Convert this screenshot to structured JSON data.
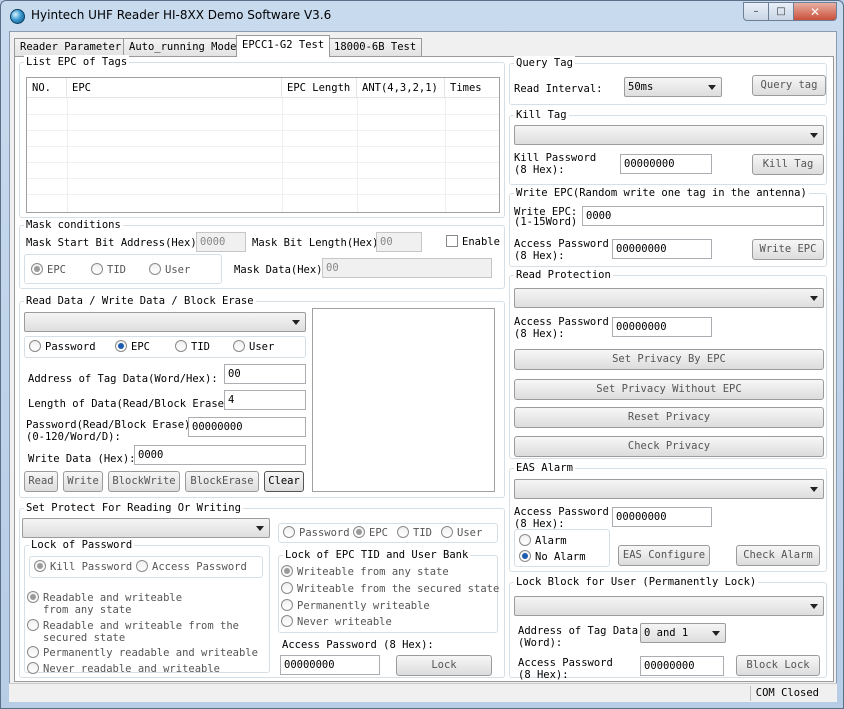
{
  "window": {
    "title": "Hyintech UHF Reader HI-8XX Demo Software V3.6",
    "min_glyph": "–",
    "max_glyph": "□",
    "close_glyph": "✕"
  },
  "tabs": [
    "Reader Parameter",
    "Auto_running Mode",
    "EPCC1-G2 Test",
    "18000-6B Test"
  ],
  "list_epc": {
    "title": "List EPC of Tags",
    "columns": [
      "NO.",
      "EPC",
      "EPC Length",
      "ANT(4,3,2,1)",
      "Times"
    ]
  },
  "mask": {
    "title": "Mask conditions",
    "start_bit_label": "Mask Start Bit Address(Hex):",
    "start_bit_value": "0000",
    "bit_length_label": "Mask Bit Length(Hex):",
    "bit_length_value": "00",
    "enable_label": "Enable",
    "radios": [
      "EPC",
      "TID",
      "User"
    ],
    "data_label": "Mask Data(Hex):",
    "data_value": "00"
  },
  "rw": {
    "title": "Read Data / Write Data / Block Erase",
    "combo_value": "",
    "radios": [
      "Password",
      "EPC",
      "TID",
      "User"
    ],
    "addr_label": "Address of Tag Data(Word/Hex):",
    "addr_value": "00",
    "len_label": "Length of Data(Read/Block Erase:",
    "len_value": "4",
    "pwd_label_1": "Password(Read/Block Erase)",
    "pwd_label_2": "(0-120/Word/D):",
    "pwd_value": "00000000",
    "write_label": "Write Data (Hex):",
    "write_value": "0000",
    "buttons": [
      "Read",
      "Write",
      "BlockWrite",
      "BlockErase",
      "Clear"
    ]
  },
  "protect": {
    "title": "Set Protect For Reading Or Writing",
    "combo_value": "",
    "lock_pwd_title": "Lock of Password",
    "lock_pwd_radios": [
      "Kill Password",
      "Access Password"
    ],
    "mem_radios": [
      "Password",
      "EPC",
      "TID",
      "User"
    ],
    "lock_bank_title": "Lock of EPC TID and User Bank",
    "left_opts": [
      [
        "Readable and  writeable",
        "from any state"
      ],
      [
        "Readable and writeable from the",
        "secured state"
      ],
      [
        "Permanently readable and writeable"
      ],
      [
        "Never readable and writeable"
      ]
    ],
    "right_opts": [
      "Writeable from any state",
      "Writeable from the secured state",
      "Permanently writeable",
      "Never writeable"
    ],
    "access_label": "Access Password (8 Hex):",
    "access_value": "00000000",
    "lock_button": "Lock"
  },
  "query": {
    "title": "Query Tag",
    "interval_label": "Read Interval:",
    "interval_value": "50ms",
    "button": "Query tag"
  },
  "kill": {
    "title": "Kill Tag",
    "combo_value": "",
    "pwd_label_1": "Kill Password",
    "pwd_label_2": "(8 Hex):",
    "pwd_value": "00000000",
    "button": "Kill Tag"
  },
  "write_epc": {
    "title": "Write EPC(Random write one tag in the antenna)",
    "epc_label_1": "Write EPC:",
    "epc_label_2": "(1-15Word)",
    "epc_value": "0000",
    "pwd_label_1": "Access Password",
    "pwd_label_2": "(8 Hex):",
    "pwd_value": "00000000",
    "button": "Write EPC"
  },
  "read_protection": {
    "title": "Read Protection",
    "combo_value": "",
    "pwd_label_1": "Access Password",
    "pwd_label_2": "(8 Hex):",
    "pwd_value": "00000000",
    "buttons": [
      "Set Privacy By EPC",
      "Set Privacy Without EPC",
      "Reset Privacy",
      "Check Privacy"
    ]
  },
  "eas": {
    "title": "EAS Alarm",
    "combo_value": "",
    "pwd_label_1": "Access Password",
    "pwd_label_2": "(8 Hex):",
    "pwd_value": "00000000",
    "radios": [
      "Alarm",
      "No Alarm"
    ],
    "configure_button": "EAS Configure",
    "check_button": "Check Alarm"
  },
  "lock_block": {
    "title": "Lock Block for User (Permanently Lock)",
    "combo_value": "",
    "addr_label_1": "Address of Tag Data",
    "addr_label_2": "(Word):",
    "addr_value": "0 and 1",
    "pwd_label_1": "Access Password",
    "pwd_label_2": "(8 Hex):",
    "pwd_value": "00000000",
    "button": "Block Lock"
  },
  "status": {
    "text": "COM Closed"
  }
}
